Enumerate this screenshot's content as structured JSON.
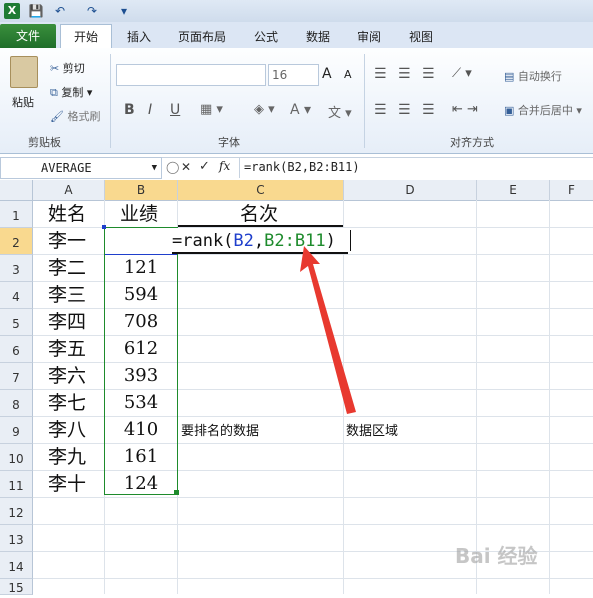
{
  "qat": {
    "save": "💾",
    "undo": "↶",
    "redo": "↷",
    "more": "▾"
  },
  "tabs": [
    {
      "label": "文件"
    },
    {
      "label": "开始"
    },
    {
      "label": "插入"
    },
    {
      "label": "页面布局"
    },
    {
      "label": "公式"
    },
    {
      "label": "数据"
    },
    {
      "label": "审阅"
    },
    {
      "label": "视图"
    }
  ],
  "ribbon": {
    "paste_label": "粘贴",
    "cut_label": "剪切",
    "copy_label": "复制",
    "format_painter_label": "格式刷",
    "clipboard_group": "剪贴板",
    "font_group": "字体",
    "align_group": "对齐方式",
    "font_size": "16",
    "wrap_text": "自动换行",
    "merge_center": "合并后居中",
    "bold": "B",
    "italic": "I",
    "underline": "U",
    "font_color": "A",
    "grow": "A",
    "shrink": "A"
  },
  "formula_bar": {
    "name_box": "AVERAGE",
    "fx": "fx",
    "cancel": "✕",
    "enter": "✓",
    "formula": "=rank(B2,B2:B11)"
  },
  "columns": [
    "A",
    "B",
    "C",
    "D",
    "E",
    "F"
  ],
  "rows": [
    "1",
    "2",
    "3",
    "4",
    "5",
    "6",
    "7",
    "8",
    "9",
    "10",
    "11",
    "12",
    "13",
    "14",
    "15"
  ],
  "cells": {
    "A1": "姓名",
    "B1": "业绩",
    "C1": "名次",
    "A2": "李一",
    "A3": "李二",
    "A4": "李三",
    "A5": "李四",
    "A6": "李五",
    "A7": "李六",
    "A8": "李七",
    "A9": "李八",
    "A10": "李九",
    "A11": "李十",
    "B3": "121",
    "B4": "594",
    "B5": "708",
    "B6": "612",
    "B7": "393",
    "B8": "534",
    "B9": "410",
    "B10": "161",
    "B11": "124"
  },
  "edit_formula": {
    "prefix": "=rank(",
    "ref1": "B2",
    "comma": ",",
    "ref2": "B2:B11",
    "suffix": ")"
  },
  "annotations": {
    "rank_data": "要排名的数据",
    "data_area": "数据区域"
  },
  "watermark": "Bai 经验",
  "colors": {
    "ref_blue": "#1f3fcc",
    "ref_green": "#1e8b2c",
    "arrow_red": "#e8392f",
    "file_tab": "#2a7f32"
  }
}
